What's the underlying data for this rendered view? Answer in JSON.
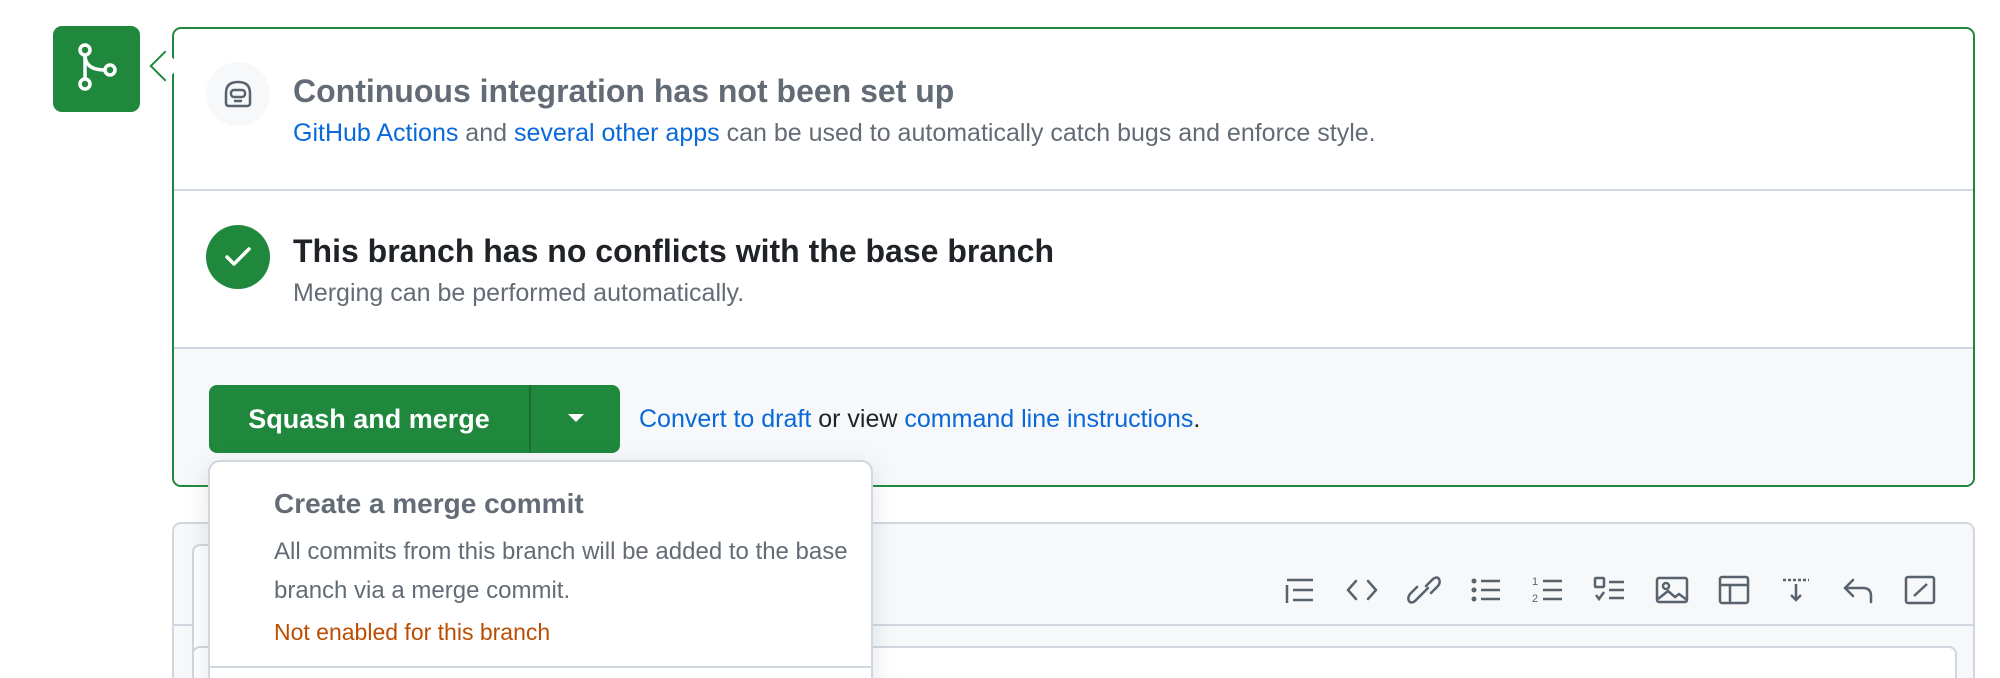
{
  "colors": {
    "success": "#1f883d",
    "link": "#0969da",
    "muted": "#636c76",
    "warning": "#bc4c00",
    "border": "#d0d7de"
  },
  "icons": {
    "merge_badge": "git-merge-icon",
    "ci": "copilot-robot-icon",
    "check": "check-icon",
    "caret": "triangle-down-icon"
  },
  "ci": {
    "title": "Continuous integration has not been set up",
    "link1": "GitHub Actions",
    "text1": " and ",
    "link2": "several other apps",
    "text2": " can be used to automatically catch bugs and enforce style."
  },
  "conflicts": {
    "title": "This branch has no conflicts with the base branch",
    "desc": "Merging can be performed automatically."
  },
  "merge": {
    "button_label": "Squash and merge",
    "link_draft": "Convert to draft",
    "text_mid": " or view ",
    "link_cli": "command line instructions",
    "text_end": "."
  },
  "dropdown": {
    "item": {
      "title": "Create a merge commit",
      "desc": "All commits from this branch will be added to the base branch via a merge commit.",
      "note": "Not enabled for this branch"
    }
  },
  "toolbar": [
    "heading-icon",
    "code-icon",
    "link-icon",
    "unordered-list-icon",
    "ordered-list-icon",
    "task-list-icon",
    "image-icon",
    "table-icon",
    "saved-replies-icon",
    "reply-icon",
    "fullscreen-icon"
  ]
}
